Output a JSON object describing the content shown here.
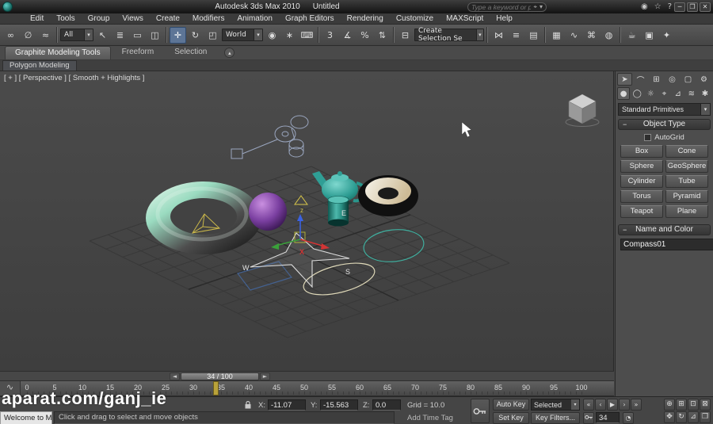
{
  "ui": {
    "caret": "▾",
    "minus": "−",
    "collapse_dot": "▴"
  },
  "titlebar": {
    "app_title": "Autodesk 3ds Max 2010",
    "doc_title": "Untitled",
    "search_placeholder": "Type a keyword or phrase",
    "search_target_glyph": "⌖",
    "icons": [
      {
        "name": "communication-center-icon",
        "g": "◉"
      },
      {
        "name": "favorites-icon",
        "g": "☆"
      },
      {
        "name": "help-icon",
        "g": "?"
      }
    ],
    "win": [
      {
        "name": "minimize-button",
        "g": "─"
      },
      {
        "name": "restore-button",
        "g": "❐"
      },
      {
        "name": "close-button",
        "g": "✕"
      }
    ]
  },
  "menubar": {
    "items": [
      "Edit",
      "Tools",
      "Group",
      "Views",
      "Create",
      "Modifiers",
      "Animation",
      "Graph Editors",
      "Rendering",
      "Customize",
      "MAXScript",
      "Help"
    ]
  },
  "toolbar": {
    "filter_value": "All",
    "coord_value": "World",
    "sets_value": "Create Selection Se",
    "icons": [
      {
        "name": "select-and-link",
        "g": "∞"
      },
      {
        "name": "unlink-selection",
        "g": "∅"
      },
      {
        "name": "bind-to-space-warp",
        "g": "≈"
      },
      {
        "name": "select-object",
        "g": "↖"
      },
      {
        "name": "select-by-name",
        "g": "≣"
      },
      {
        "name": "rectangular-selection-region",
        "g": "▭"
      },
      {
        "name": "window-crossing-toggle",
        "g": "◫"
      },
      {
        "name": "select-and-move",
        "g": "✛"
      },
      {
        "name": "select-and-rotate",
        "g": "↻"
      },
      {
        "name": "select-and-scale",
        "g": "◰"
      },
      {
        "name": "use-pivot-point-center",
        "g": "◉"
      },
      {
        "name": "select-and-manipulate",
        "g": "∗"
      },
      {
        "name": "keyboard-shortcut-override",
        "g": "⌨"
      },
      {
        "name": "snap-toggle-3d",
        "g": "3"
      },
      {
        "name": "angle-snap",
        "g": "∡"
      },
      {
        "name": "percent-snap",
        "g": "%"
      },
      {
        "name": "spinner-snap",
        "g": "⇅"
      },
      {
        "name": "edit-named-selection-sets",
        "g": "⊟"
      },
      {
        "name": "mirror",
        "g": "⋈"
      },
      {
        "name": "align",
        "g": "≡"
      },
      {
        "name": "layer-manager",
        "g": "▤"
      },
      {
        "name": "graphite-modeling-toggle",
        "g": "▦"
      },
      {
        "name": "curve-editor",
        "g": "∿"
      },
      {
        "name": "schematic-view",
        "g": "⌘"
      },
      {
        "name": "material-editor",
        "g": "◍"
      },
      {
        "name": "render-setup",
        "g": "☕"
      },
      {
        "name": "rendered-frame-window",
        "g": "▣"
      },
      {
        "name": "render-production",
        "g": "✦"
      }
    ]
  },
  "ribbon": {
    "tabs": [
      "Graphite Modeling Tools",
      "Freeform",
      "Selection"
    ],
    "subtab": "Polygon Modeling"
  },
  "viewport": {
    "label": "[ + ] [ Perspective ] [ Smooth + Highlights ]",
    "letters": {
      "e": "E",
      "s": "S",
      "w": "W",
      "z": "z",
      "x": "X"
    }
  },
  "command_panel": {
    "tabs": [
      {
        "name": "create-tab",
        "g": "➤"
      },
      {
        "name": "modify-tab",
        "g": "⌒"
      },
      {
        "name": "hierarchy-tab",
        "g": "⊞"
      },
      {
        "name": "motion-tab",
        "g": "◎"
      },
      {
        "name": "display-tab",
        "g": "▢"
      },
      {
        "name": "utilities-tab",
        "g": "⚙"
      }
    ],
    "categories": [
      {
        "name": "geometry-category",
        "g": "●"
      },
      {
        "name": "shapes-category",
        "g": "◯"
      },
      {
        "name": "lights-category",
        "g": "☼"
      },
      {
        "name": "cameras-category",
        "g": "⌖"
      },
      {
        "name": "helpers-category",
        "g": "⊿"
      },
      {
        "name": "spacewarps-category",
        "g": "≋"
      },
      {
        "name": "systems-category",
        "g": "✱"
      }
    ],
    "dropdown": "Standard Primitives",
    "object_type_title": "Object Type",
    "autogrid_label": "AutoGrid",
    "object_buttons": [
      "Box",
      "Cone",
      "Sphere",
      "GeoSphere",
      "Cylinder",
      "Tube",
      "Torus",
      "Pyramid",
      "Teapot",
      "Plane"
    ],
    "name_color_title": "Name and Color",
    "object_name": "Compass01"
  },
  "timeline": {
    "slider_value": "34 / 100",
    "prev": "◄",
    "next": "►",
    "current_frame": 34,
    "ticks": [
      "0",
      "5",
      "10",
      "15",
      "20",
      "25",
      "30",
      "35",
      "40",
      "45",
      "50",
      "55",
      "60",
      "65",
      "70",
      "75",
      "80",
      "85",
      "90",
      "95",
      "100"
    ]
  },
  "statusbar": {
    "x_label": "X:",
    "x_value": "-11.07",
    "y_label": "Y:",
    "y_value": "-15.563",
    "z_label": "Z:",
    "z_value": "0.0",
    "grid_label": "Grid = 10.0",
    "add_time_tag": "Add Time Tag",
    "auto_key": "Auto Key",
    "set_key": "Set Key",
    "selected_value": "Selected",
    "key_filters": "Key Filters...",
    "frame_value": "34",
    "prompt": "Click and drag to select and move objects",
    "welcome": "Welcome to M",
    "minicurve_glyph": "∿",
    "timecfg_glyph": "◔",
    "playback": [
      {
        "name": "go-to-start",
        "g": "«"
      },
      {
        "name": "previous-frame",
        "g": "‹"
      },
      {
        "name": "play-animation",
        "g": "▶"
      },
      {
        "name": "next-frame",
        "g": "›"
      },
      {
        "name": "go-to-end",
        "g": "»"
      }
    ],
    "nav": [
      {
        "name": "zoom",
        "g": "⊕"
      },
      {
        "name": "zoom-all",
        "g": "⊞"
      },
      {
        "name": "zoom-extents",
        "g": "⊡"
      },
      {
        "name": "zoom-region",
        "g": "⊠"
      },
      {
        "name": "pan-view",
        "g": "✥"
      },
      {
        "name": "orbit-view",
        "g": "↻"
      },
      {
        "name": "dolly-view",
        "g": "⊿"
      },
      {
        "name": "maximize-viewport-toggle",
        "g": "❒"
      }
    ]
  },
  "watermark": "aparat.com/ganj_ie",
  "colors": {
    "marker_yellow": "#b9a23a",
    "active_tool_blue": "#5d7596",
    "axis_x": "#d23535",
    "axis_y": "#3aa03a",
    "axis_z": "#3b62e0",
    "torus_highlight": "#d9f3e4",
    "sphere_purple": "#8a4fb0",
    "teapot_teal": "#35a79d",
    "donut_cream": "#efe9d9",
    "logo_teal": "#1f8f8f"
  }
}
